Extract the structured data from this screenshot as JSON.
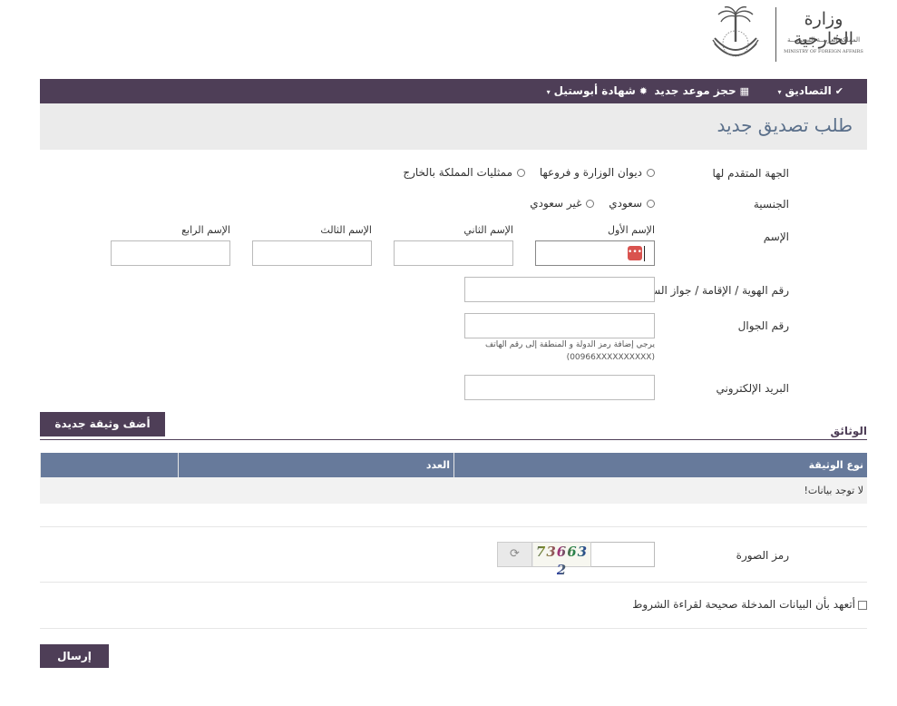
{
  "header": {
    "logo_title": "وزارة الخارجية",
    "logo_subtitle_ar": "المملكة العربيــة السعوديــة",
    "logo_subtitle_en": "MINISTRY OF FOREIGN AFFAIRS"
  },
  "nav": {
    "items": [
      {
        "label": "التصاديق",
        "icon": "check-circle-icon"
      },
      {
        "label": "حجز موعد جديد",
        "icon": "calendar-icon"
      },
      {
        "label": "شهادة أبوستيل",
        "icon": "gear-icon"
      }
    ]
  },
  "page": {
    "title": "طلب تصديق جديد"
  },
  "form": {
    "applicant_label": "الجهة المتقدم لها",
    "applicant_options": [
      "ديوان الوزارة و فروعها",
      "ممثليات المملكة بالخارج"
    ],
    "nationality_label": "الجنسية",
    "nationality_options": [
      "سعودي",
      "غير سعودي"
    ],
    "name_label": "الإسم",
    "name_parts": [
      "الإسم الأول",
      "الإسم الثاني",
      "الإسم الثالث",
      "الإسم الرابع"
    ],
    "id_label": "رقم الهوية / الإقامة / جواز السفر",
    "mobile_label": "رقم الجوال",
    "mobile_hint_line1": "يرجي إضافة رمز الدولة و المنطقة إلى رقم الهاتف",
    "mobile_hint_line2": "(00966XXXXXXXXXX)",
    "email_label": "البريد الإلكتروني"
  },
  "documents": {
    "add_button": "أضف وثيقة جديدة",
    "section_title": "الوثائق",
    "columns": [
      "نوع الوثيقة",
      "العدد",
      ""
    ],
    "empty_text": "لا توجد بيانات!"
  },
  "captcha": {
    "label": "رمز الصورة",
    "code": "73663 2"
  },
  "agreement": {
    "text": "أتعهد بأن البيانات المدخلة صحيحة لقراءة الشروط"
  },
  "submit": {
    "label": "إرسال"
  },
  "colors": {
    "primary": "#4e3e57",
    "table_header": "#677a9b",
    "title_text": "#5a6f8a"
  }
}
